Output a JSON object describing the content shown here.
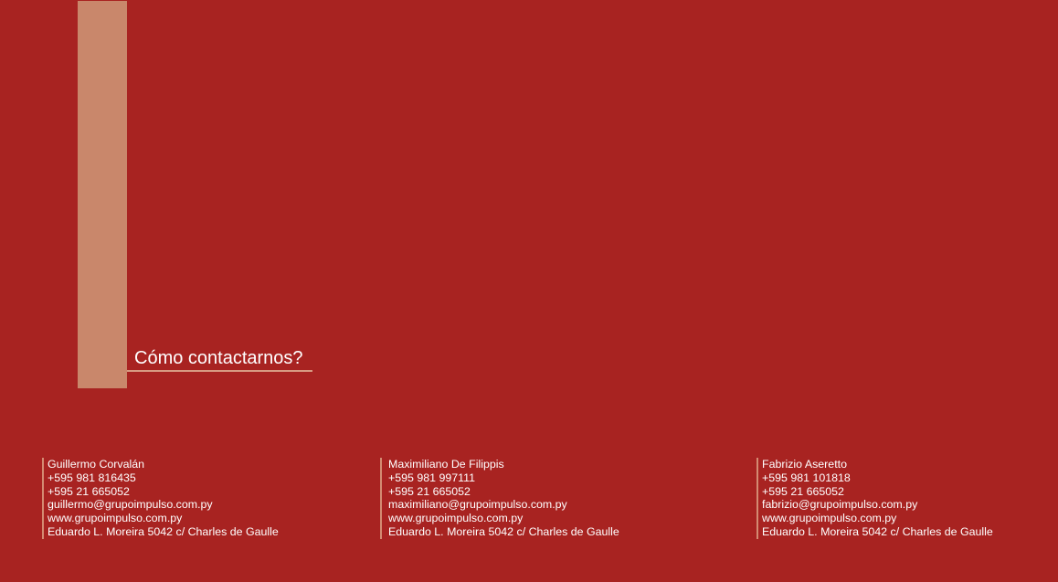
{
  "heading": "Cómo contactarnos?",
  "contacts": [
    {
      "name": "Guillermo Corvalán",
      "mobile": "+595 981 816435",
      "phone": "+595 21 665052",
      "email": "guillermo@grupoimpulso.com.py",
      "website": "www.grupoimpulso.com.py",
      "address": "Eduardo L. Moreira 5042 c/ Charles de Gaulle"
    },
    {
      "name": "Maximiliano De Filippis",
      "mobile": "+595 981 997111",
      "phone": "+595 21 665052",
      "email": "maximiliano@grupoimpulso.com.py",
      "website": "www.grupoimpulso.com.py",
      "address": "Eduardo L. Moreira 5042 c/ Charles de Gaulle"
    },
    {
      "name": "Fabrizio Aseretto",
      "mobile": "+595 981 101818",
      "phone": "+595 21 665052",
      "email": "fabrizio@grupoimpulso.com.py",
      "website": "www.grupoimpulso.com.py",
      "address": "Eduardo L. Moreira 5042 c/ Charles de Gaulle"
    }
  ],
  "colors": {
    "background": "#a82321",
    "accent_bar": "#c9876b",
    "underline": "#d79a82",
    "contact_divider": "#d48b72",
    "text": "#ffffff"
  }
}
